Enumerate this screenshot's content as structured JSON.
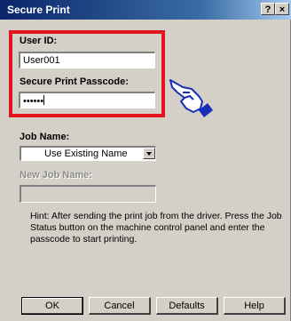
{
  "window": {
    "title": "Secure Print",
    "help_button": "?",
    "close_button": "×"
  },
  "fields": {
    "user_id_label": "User ID:",
    "user_id_value": "User001",
    "passcode_label": "Secure Print Passcode:",
    "passcode_value": "••••••",
    "job_name_label": "Job Name:",
    "job_name_selected": "Use Existing Name",
    "new_job_name_label": "New Job Name:",
    "new_job_name_value": ""
  },
  "hint": "Hint: After sending the print job from the driver. Press the Job Status button on the machine control panel and enter the passcode to start printing.",
  "buttons": {
    "ok": "OK",
    "cancel": "Cancel",
    "defaults": "Defaults",
    "help": "Help"
  },
  "colors": {
    "highlight_border": "#e2141e",
    "pointer_hand": "#1a2fb8"
  },
  "icons": {
    "pointer": "pointing-hand-icon"
  }
}
